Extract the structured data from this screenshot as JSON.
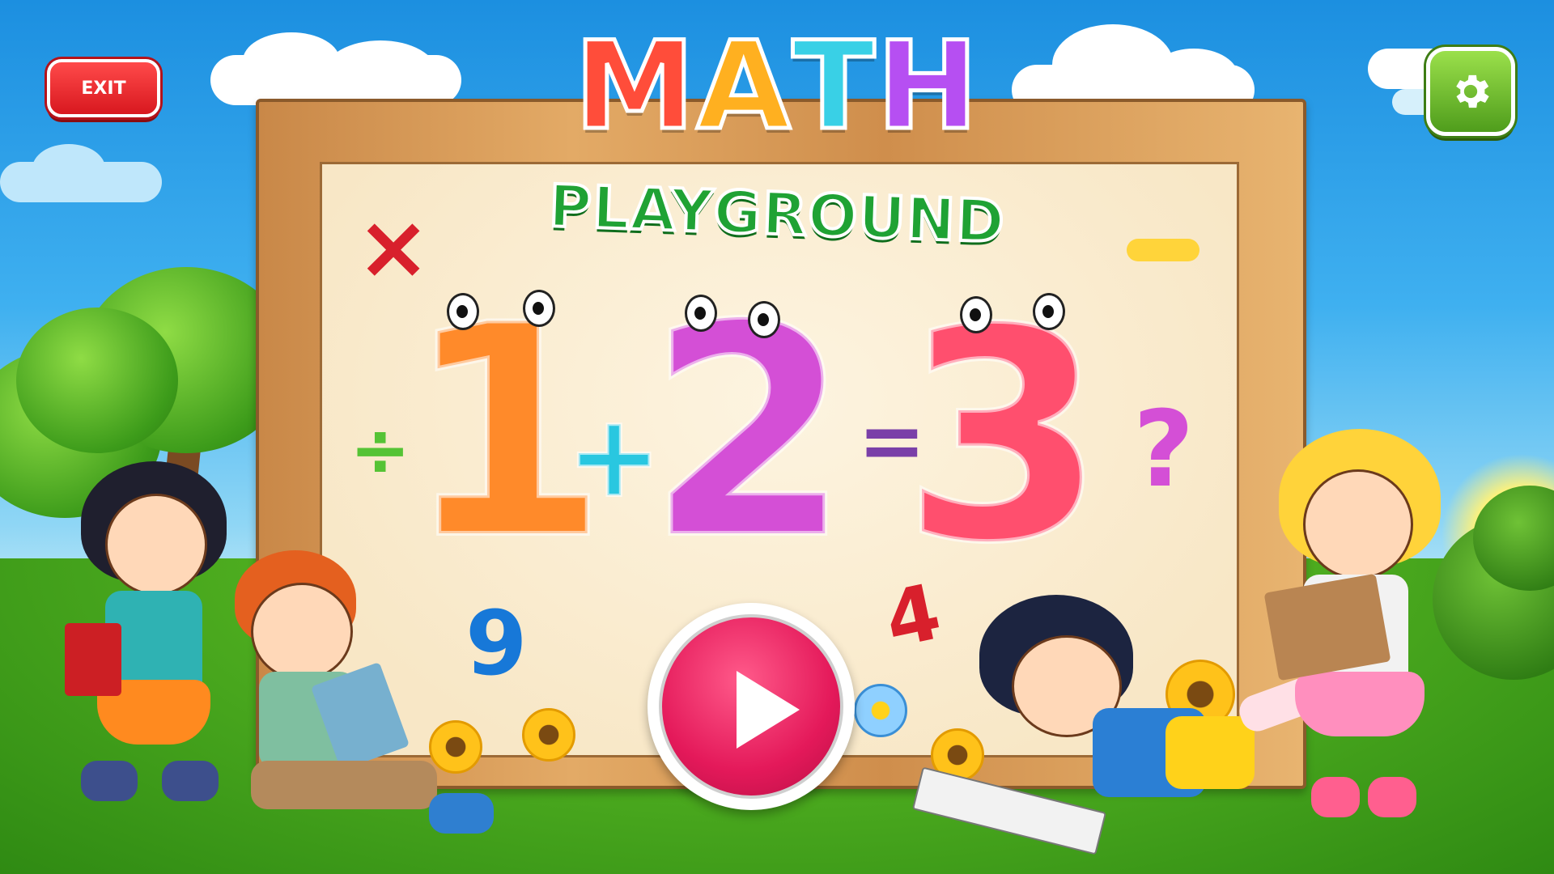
{
  "header": {
    "exit_label": "EXIT",
    "settings_icon": "gear-icon"
  },
  "title": {
    "letters": [
      "M",
      "A",
      "T",
      "H"
    ],
    "letter_colors": [
      "#ff4d3a",
      "#ffb020",
      "#39d0e6",
      "#b64ff2"
    ],
    "subtitle": "PLAYGROUND"
  },
  "board": {
    "equation": {
      "first": "1",
      "plus": "+",
      "second": "2",
      "equals": "=",
      "result": "3"
    },
    "symbols": {
      "times": "×",
      "minus": "−",
      "divide": "÷",
      "question": "?",
      "nine": "9",
      "four": "4"
    },
    "colors": {
      "one": "#ff8a2a",
      "two": "#d44fd6",
      "three": "#ff4f6e",
      "plus": "#29c7e0",
      "equals": "#7a3fa8"
    }
  },
  "play_button": {
    "icon": "play-icon",
    "color": "#e4195a"
  }
}
